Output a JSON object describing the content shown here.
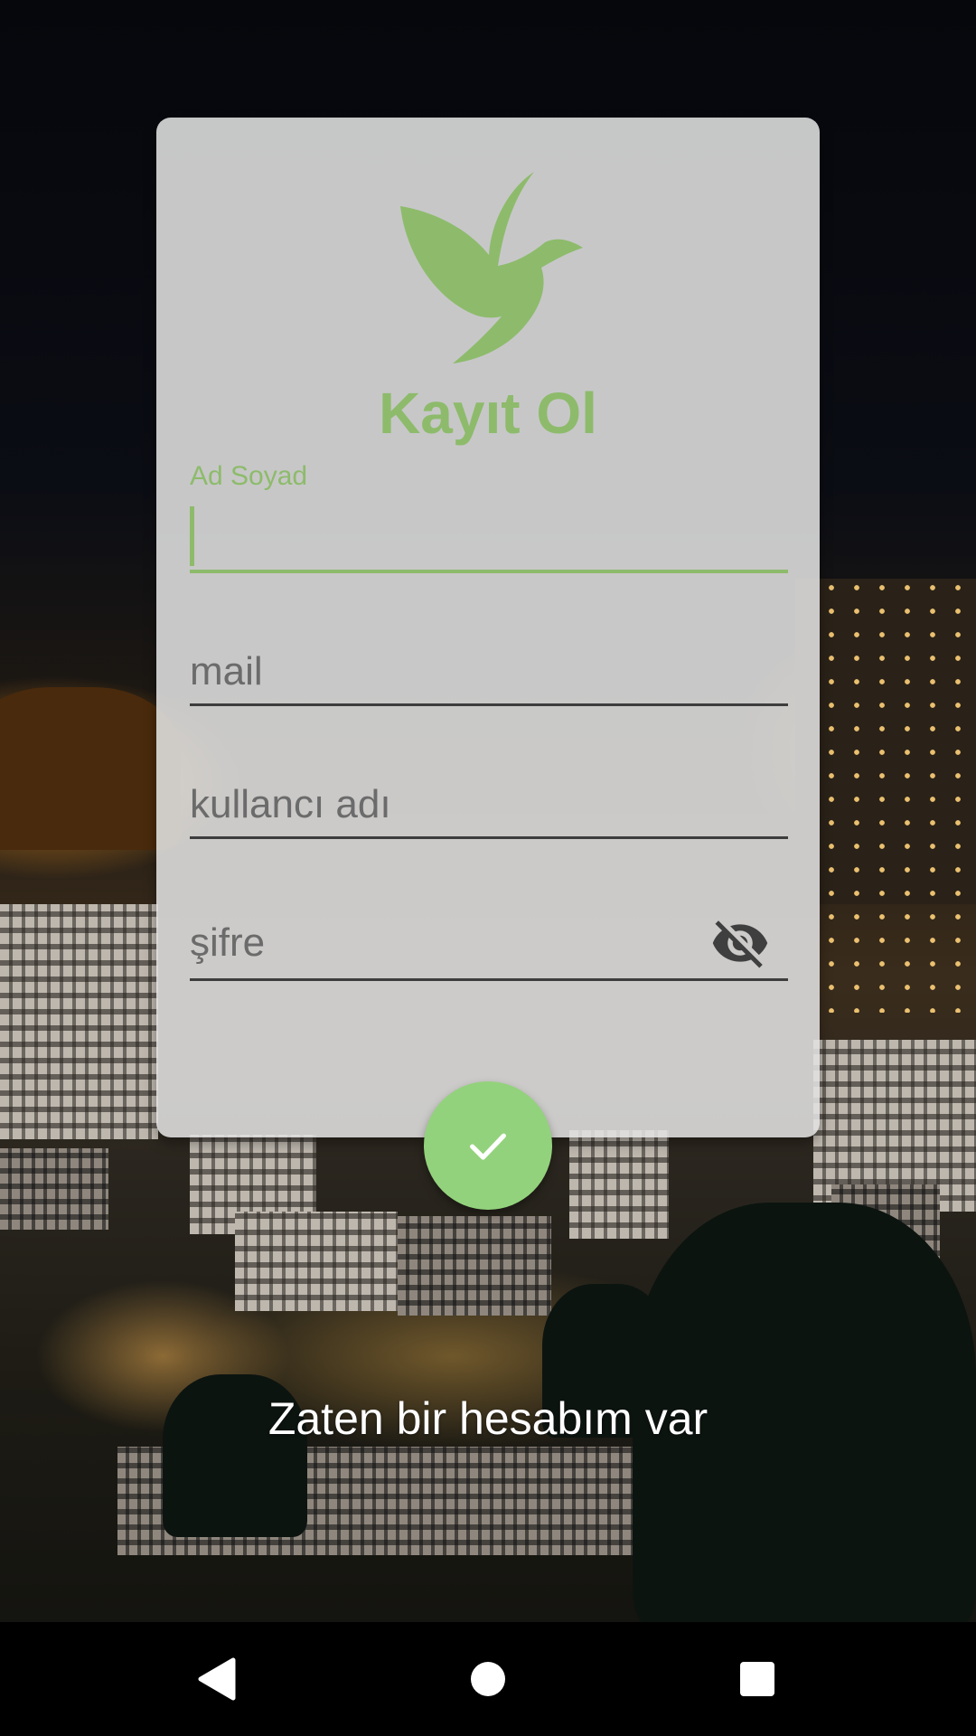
{
  "title": "Kayıt Ol",
  "fields": {
    "fullname": {
      "label": "Ad Soyad",
      "value": "",
      "placeholder": ""
    },
    "email": {
      "placeholder": "mail",
      "value": ""
    },
    "username": {
      "placeholder": "kullancı adı",
      "value": ""
    },
    "password": {
      "placeholder": "şifre",
      "value": "",
      "toggle_icon": "eye-off-icon"
    }
  },
  "submit": {
    "icon": "check-icon"
  },
  "login_link": "Zaten bir hesabım var",
  "colors": {
    "accent": "#8dbb6b",
    "fab": "#93d27c",
    "card": "#e1e1e1"
  },
  "navbar": {
    "back_icon": "back-triangle-icon",
    "home_icon": "home-circle-icon",
    "recents_icon": "recents-square-icon"
  }
}
